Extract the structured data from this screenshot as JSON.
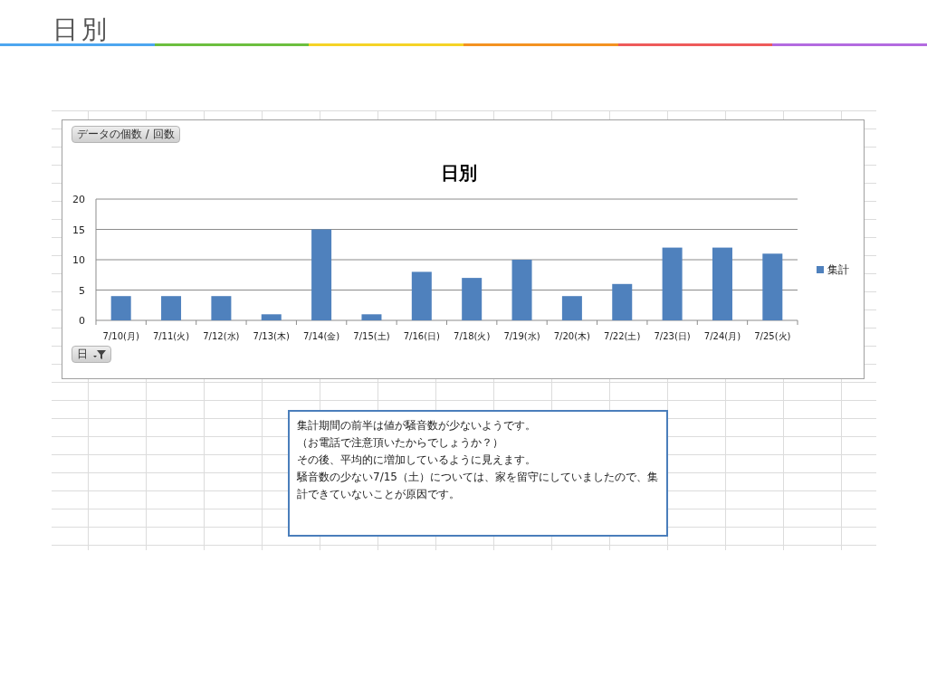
{
  "slide": {
    "title": "日別"
  },
  "chart": {
    "field_button": "データの個数 / 回数",
    "axis_button": "日",
    "chart_data": {
      "type": "bar",
      "title": "日別",
      "categories": [
        "7/10(月)",
        "7/11(火)",
        "7/12(水)",
        "7/13(木)",
        "7/14(金)",
        "7/15(土)",
        "7/16(日)",
        "7/18(火)",
        "7/19(水)",
        "7/20(木)",
        "7/22(土)",
        "7/23(日)",
        "7/24(月)",
        "7/25(火)"
      ],
      "series": [
        {
          "name": "集計",
          "color": "#4f81bd",
          "values": [
            4,
            4,
            4,
            1,
            15,
            1,
            8,
            7,
            10,
            4,
            6,
            12,
            12,
            11
          ]
        }
      ],
      "ylim": [
        0,
        20
      ],
      "yticks": [
        0,
        5,
        10,
        15,
        20
      ],
      "grid": true
    }
  },
  "comment": {
    "lines": [
      "集計期間の前半は値が騒音数が少ないようです。",
      "（お電話で注意頂いたからでしょうか？）",
      "その後、平均的に増加しているように見えます。",
      "騒音数の少ない7/15（土）については、家を留守にしていましたので、集計できていないことが原因です。"
    ]
  }
}
